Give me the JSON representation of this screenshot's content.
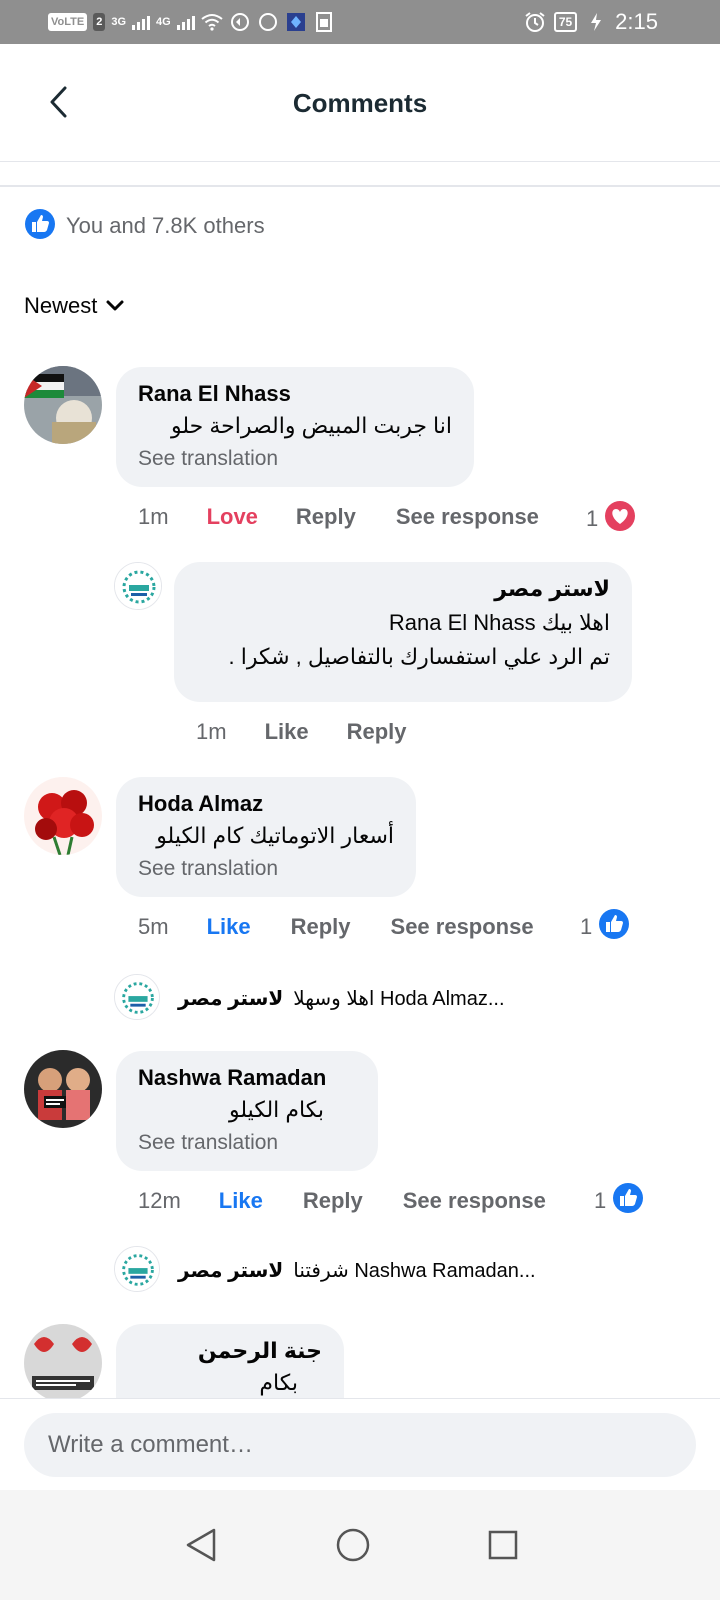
{
  "status_bar": {
    "left_chips": [
      "VoLTE",
      "2"
    ],
    "net1": "3G",
    "net2": "4G",
    "battery": "75",
    "time": "2:15"
  },
  "header": {
    "title": "Comments",
    "back_icon": "chevron-left-icon"
  },
  "reactions": {
    "summary": "You and 7.8K others",
    "icon": "like-icon"
  },
  "sort": {
    "label": "Newest",
    "icon": "chevron-down-icon"
  },
  "comments": [
    {
      "name": "Rana El Nhass",
      "text": "انا جربت المبيض والصراحة حلو",
      "translate": "See translation",
      "time": "1m",
      "reaction_label": "Love",
      "reply": "Reply",
      "see_response": "See response",
      "count": "1",
      "count_icon": "love-icon",
      "reply_thread": {
        "name": "لاستر مصر",
        "line1": "اهلا بيك  Rana El Nhass",
        "line2": "تم الرد علي استفسارك بالتفاصيل ,  شكرا .",
        "time": "1m",
        "like": "Like",
        "reply": "Reply"
      }
    },
    {
      "name": "Hoda Almaz",
      "text": "أسعار الاتوماتيك كام الكيلو",
      "translate": "See translation",
      "time": "5m",
      "reaction_label": "Like",
      "reply": "Reply",
      "see_response": "See response",
      "count": "1",
      "count_icon": "like-icon",
      "collapsed_reply": {
        "name": "لاستر مصر",
        "text": "اهلا وسهلا  Hoda Almaz..."
      }
    },
    {
      "name": "Nashwa Ramadan",
      "text": "بكام  الكيلو",
      "translate": "See translation",
      "time": "12m",
      "reaction_label": "Like",
      "reply": "Reply",
      "see_response": "See response",
      "count": "1",
      "count_icon": "like-icon",
      "collapsed_reply": {
        "name": "لاستر مصر",
        "text": "شرفتنا  Nashwa Ramadan..."
      }
    },
    {
      "name": "جنة الرحمن",
      "text": "بكام"
    }
  ],
  "composer": {
    "placeholder": "Write a comment…"
  },
  "nav": {
    "back": "nav-back-icon",
    "home": "nav-home-icon",
    "recents": "nav-recents-icon"
  },
  "colors": {
    "like_blue": "#1877f2",
    "love_red": "#e4405f",
    "bubble_bg": "#f0f2f5",
    "muted_text": "#65676b",
    "status_bar": "#8f8f8f"
  }
}
